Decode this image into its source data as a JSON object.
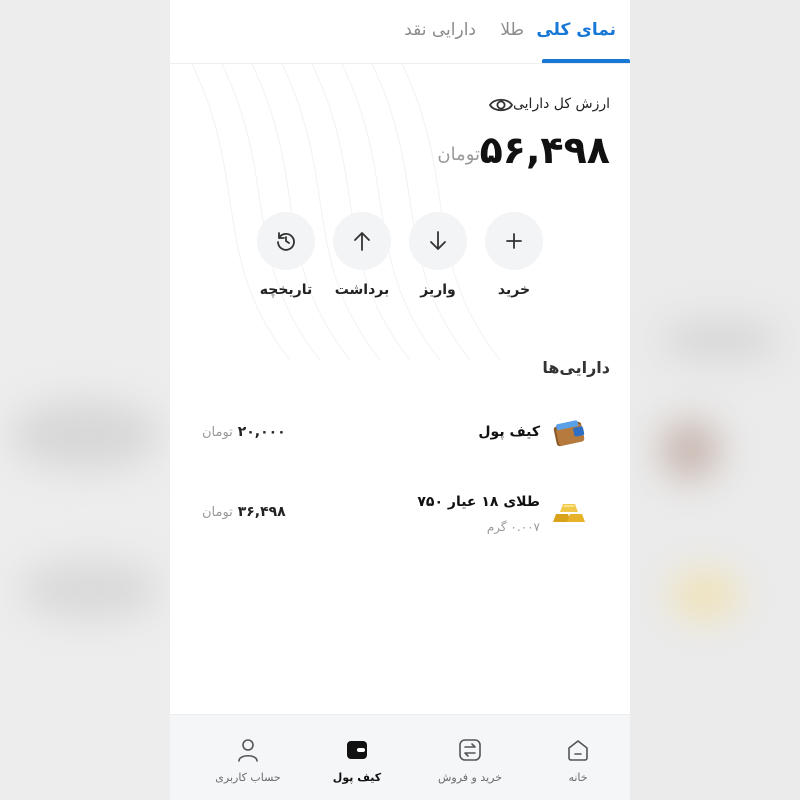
{
  "tabs": [
    {
      "label": "نمای کلی",
      "active": true
    },
    {
      "label": "طلا",
      "active": false
    },
    {
      "label": "دارایی نقد",
      "active": false
    }
  ],
  "summary": {
    "label": "ارزش کل دارایی",
    "value": "۵۶,۴۹۸",
    "unit": "تومان"
  },
  "actions": [
    {
      "label": "خرید",
      "icon": "plus-icon"
    },
    {
      "label": "واریز",
      "icon": "arrow-down-icon"
    },
    {
      "label": "برداشت",
      "icon": "arrow-up-icon"
    },
    {
      "label": "تاریخچه",
      "icon": "history-icon"
    }
  ],
  "assets": {
    "title": "دارایی‌ها",
    "items": [
      {
        "name": "کیف پول",
        "sub": "",
        "amount": "۲۰,۰۰۰",
        "unit": "تومان",
        "icon": "wallet-icon"
      },
      {
        "name": "طلای ۱۸ عیار ۷۵۰",
        "sub": "۰.۰۰۷ گرم",
        "amount": "۳۶,۴۹۸",
        "unit": "تومان",
        "icon": "gold-bars-icon"
      }
    ]
  },
  "bottom_nav": [
    {
      "label": "خانه",
      "icon": "home-icon",
      "active": false
    },
    {
      "label": "خرید و فروش",
      "icon": "exchange-icon",
      "active": false
    },
    {
      "label": "کیف پول",
      "icon": "wallet-icon",
      "active": true
    },
    {
      "label": "حساب کاربری",
      "icon": "user-icon",
      "active": false
    }
  ],
  "colors": {
    "accent": "#1778d6",
    "text": "#111111",
    "muted": "#9a9a9a"
  }
}
